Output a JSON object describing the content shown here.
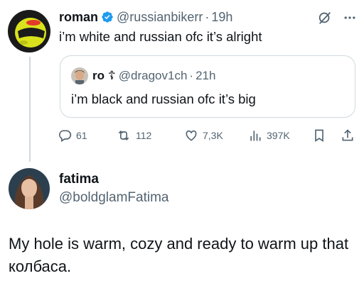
{
  "main_tweet": {
    "author_name": "roman",
    "author_handle": "@russianbikerr",
    "separator": "·",
    "time": "19h",
    "text": "i’m white and russian ofc it’s alright",
    "verified": true,
    "avatar": "yellow-helmet-avatar"
  },
  "quoted_tweet": {
    "author_name": "ro ☦",
    "author_handle": "@dragov1ch",
    "separator": "·",
    "time": "21h",
    "text": "i’m black and russian ofc it’s big",
    "avatar": "person-avatar"
  },
  "actions": {
    "replies": "61",
    "retweets": "112",
    "likes": "7,3K",
    "views": "397K"
  },
  "reply": {
    "author_name": "fatima",
    "author_handle": "@boldglamFatima",
    "text": "My hole is warm, cozy and ready to warm up that колбаса.",
    "avatar": "woman-portrait-avatar"
  },
  "colors": {
    "text": "#0f1419",
    "muted": "#536471",
    "verified_blue": "#1d9bf0",
    "border": "#cfd9de"
  },
  "icons": [
    "verified-badge-icon",
    "grok-icon",
    "more-icon",
    "reply-icon",
    "retweet-icon",
    "like-icon",
    "views-icon",
    "bookmark-icon",
    "share-icon"
  ]
}
